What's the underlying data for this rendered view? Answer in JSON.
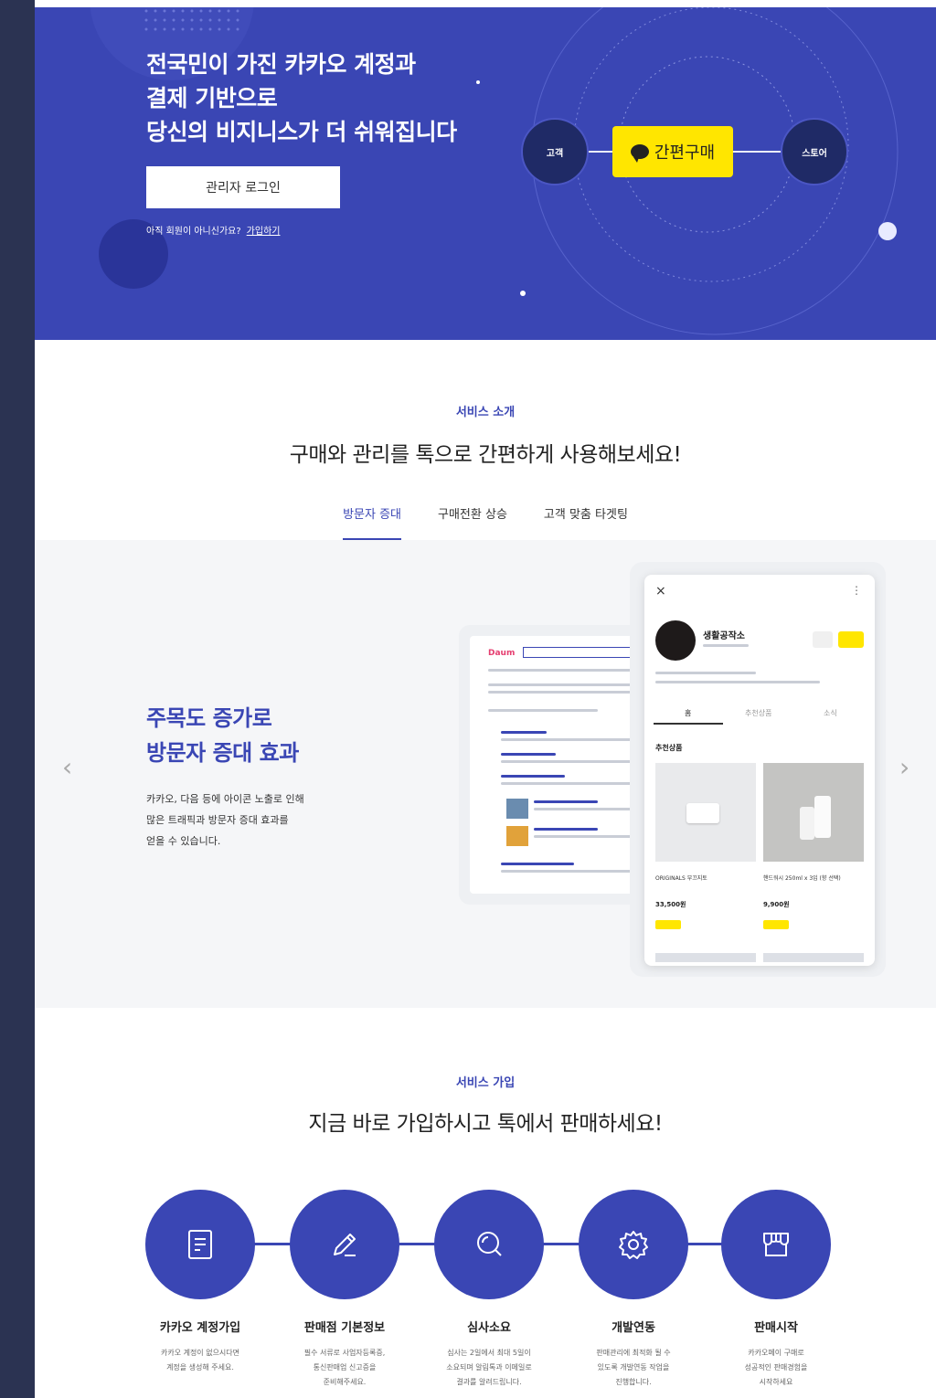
{
  "hero": {
    "headline": [
      "전국민이 가진 카카오 계정과",
      "결제 기반으로",
      "당신의 비지니스가 더 쉬워집니다"
    ],
    "login_button": "관리자 로그인",
    "signup_prompt": "아직 회원이 아니신가요?",
    "signup_link": "가입하기",
    "nodes": {
      "left": "고객",
      "center": "간편구매",
      "right": "스토어"
    }
  },
  "intro": {
    "label": "서비스 소개",
    "title": "구매와 관리를 톡으로 간편하게 사용해보세요!",
    "tabs": [
      "방문자 증대",
      "구매전환 상승",
      "고객 맞춤 타겟팅"
    ],
    "active_tab": 0
  },
  "feature": {
    "title": [
      "주목도 증가로",
      "방문자 증대 효과"
    ],
    "desc": [
      "카카오, 다음 등에 아이콘 노출로 인해",
      "많은 트래픽과 방문자 증대 효과를",
      "얻을 수 있습니다."
    ],
    "browser_logo": "Daum",
    "phone": {
      "store_name": "생활공작소",
      "tabs": [
        "홈",
        "추천상품",
        "소식"
      ],
      "section": "추천상품",
      "products": [
        {
          "name": "ORIGINALS 부끄지토",
          "price": "33,500원"
        },
        {
          "name": "핸드워시 250ml x 3입 (향 선택)",
          "price": "9,900원"
        }
      ]
    }
  },
  "signup": {
    "label": "서비스 가입",
    "title": "지금 바로 가입하시고 톡에서 판매하세요!",
    "steps": [
      {
        "name": "카카오 계정가입",
        "icon": "document-icon",
        "desc": [
          "카카오 계정이 없으시다면",
          "계정을 생성해 주세요."
        ]
      },
      {
        "name": "판매점 기본정보",
        "icon": "pencil-icon",
        "desc": [
          "필수 서류로 사업자등록증,",
          "통신판매업 신고증을",
          "준비해주세요."
        ]
      },
      {
        "name": "심사소요",
        "icon": "search-icon",
        "desc": [
          "심사는 2일에서 최대 5일이",
          "소요되며 알림톡과 이메일로",
          "결과를 알려드립니다."
        ]
      },
      {
        "name": "개발연동",
        "icon": "gear-icon",
        "desc": [
          "판매관리에 최적화 될 수",
          "있도록 개발연동 작업을",
          "진행합니다."
        ]
      },
      {
        "name": "판매시작",
        "icon": "store-icon",
        "desc": [
          "카카오페이 구매로",
          "성공적인 판매경험을",
          "시작하세요"
        ]
      }
    ]
  },
  "colors": {
    "brand": "#3a46b4",
    "kakao_yellow": "#ffe600",
    "sidebar": "#2b3352"
  }
}
